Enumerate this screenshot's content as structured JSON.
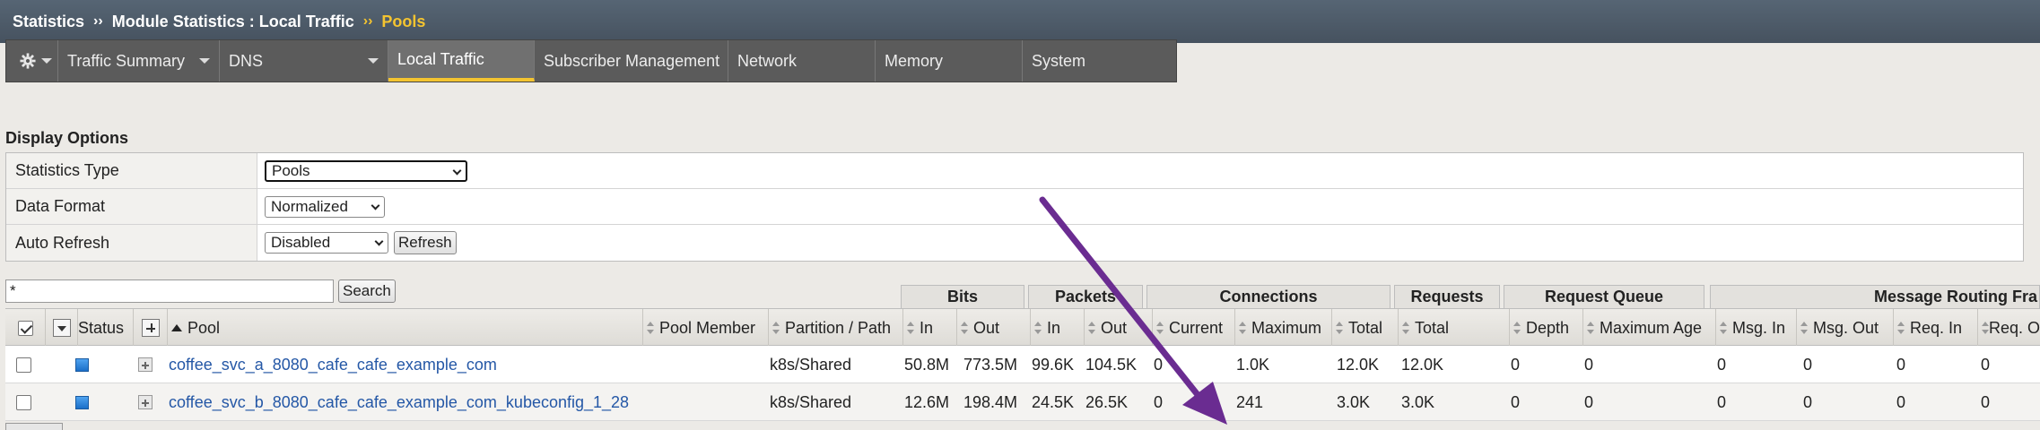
{
  "breadcrumb": {
    "parts": [
      "Statistics",
      "Module Statistics : Local Traffic"
    ],
    "separator": "››",
    "current": "Pools"
  },
  "tabs": [
    {
      "label": "",
      "icon": "gear-icon"
    },
    {
      "label": "Traffic Summary"
    },
    {
      "label": "DNS"
    },
    {
      "label": "Local Traffic",
      "active": true
    },
    {
      "label": "Subscriber Management"
    },
    {
      "label": "Network"
    },
    {
      "label": "Memory"
    },
    {
      "label": "System"
    }
  ],
  "display_options": {
    "title": "Display Options",
    "rows": [
      {
        "label": "Statistics Type",
        "value": "Pools"
      },
      {
        "label": "Data Format",
        "value": "Normalized"
      },
      {
        "label": "Auto Refresh",
        "value": "Disabled",
        "button": "Refresh"
      }
    ]
  },
  "search": {
    "value": "*",
    "button": "Search"
  },
  "groups": [
    "Bits",
    "Packets",
    "Connections",
    "Requests",
    "Request Queue",
    "Message Routing Fra"
  ],
  "columns": [
    "Status",
    "Pool",
    "Pool Member",
    "Partition / Path",
    "In",
    "Out",
    "In",
    "Out",
    "Current",
    "Maximum",
    "Total",
    "Total",
    "Depth",
    "Maximum Age",
    "Msg. In",
    "Msg. Out",
    "Req. In",
    "Req. O"
  ],
  "rows": [
    {
      "pool": "coffee_svc_a_8080_cafe_cafe_example_com",
      "partition": "k8s/Shared",
      "bits_in": "50.8M",
      "bits_out": "773.5M",
      "pkts_in": "99.6K",
      "pkts_out": "104.5K",
      "conn_current": "0",
      "conn_max": "1.0K",
      "conn_total": "12.0K",
      "req_total": "12.0K",
      "rq_depth": "0",
      "rq_max_age": "0",
      "msg_in": "0",
      "msg_out": "0",
      "req_in": "0",
      "req_out": "0"
    },
    {
      "pool": "coffee_svc_b_8080_cafe_cafe_example_com_kubeconfig_1_28",
      "partition": "k8s/Shared",
      "bits_in": "12.6M",
      "bits_out": "198.4M",
      "pkts_in": "24.5K",
      "pkts_out": "26.5K",
      "conn_current": "0",
      "conn_max": "241",
      "conn_total": "3.0K",
      "req_total": "3.0K",
      "rq_depth": "0",
      "rq_max_age": "0",
      "msg_in": "0",
      "msg_out": "0",
      "req_in": "0",
      "req_out": "0"
    }
  ],
  "colors": {
    "accent": "#f4c430",
    "link": "#2457a6",
    "annotation_arrow": "#6a2c91"
  }
}
